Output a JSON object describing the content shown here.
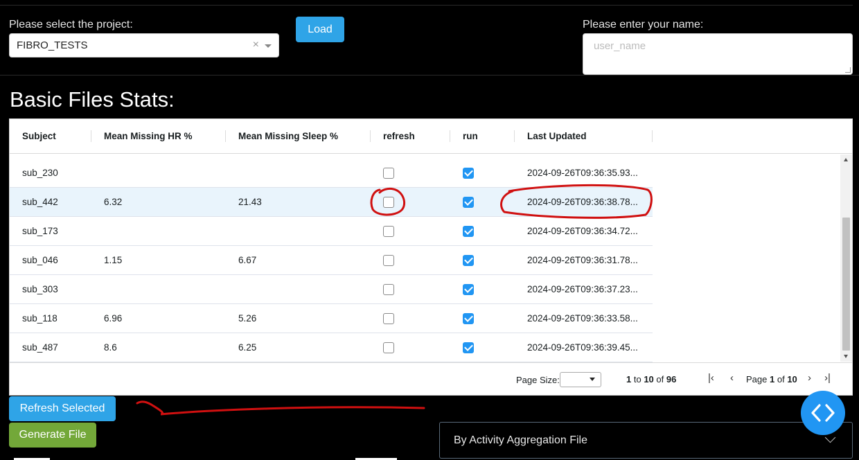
{
  "project": {
    "label": "Please select the project:",
    "selected": "FIBRO_TESTS",
    "clear_glyph": "×"
  },
  "load_button": "Load",
  "name_field": {
    "label": "Please enter your name:",
    "placeholder": "user_name"
  },
  "section_title": "Basic Files Stats:",
  "table": {
    "columns": [
      "Subject",
      "Mean Missing HR %",
      "Mean Missing Sleep %",
      "refresh",
      "run",
      "Last Updated"
    ],
    "rows": [
      {
        "subject": "sub_230",
        "hr": "",
        "sleep": "",
        "refresh": false,
        "run": true,
        "updated": "2024-09-26T09:36:35.93...",
        "selected": false
      },
      {
        "subject": "sub_442",
        "hr": "6.32",
        "sleep": "21.43",
        "refresh": false,
        "run": true,
        "updated": "2024-09-26T09:36:38.78...",
        "selected": true
      },
      {
        "subject": "sub_173",
        "hr": "",
        "sleep": "",
        "refresh": false,
        "run": true,
        "updated": "2024-09-26T09:36:34.72...",
        "selected": false
      },
      {
        "subject": "sub_046",
        "hr": "1.15",
        "sleep": "6.67",
        "refresh": false,
        "run": true,
        "updated": "2024-09-26T09:36:31.78...",
        "selected": false
      },
      {
        "subject": "sub_303",
        "hr": "",
        "sleep": "",
        "refresh": false,
        "run": true,
        "updated": "2024-09-26T09:36:37.23...",
        "selected": false
      },
      {
        "subject": "sub_118",
        "hr": "6.96",
        "sleep": "5.26",
        "refresh": false,
        "run": true,
        "updated": "2024-09-26T09:36:33.58...",
        "selected": false
      },
      {
        "subject": "sub_487",
        "hr": "8.6",
        "sleep": "6.25",
        "refresh": false,
        "run": true,
        "updated": "2024-09-26T09:36:39.45...",
        "selected": false
      }
    ]
  },
  "pagination": {
    "page_size_label": "Page Size:",
    "row_from": "1",
    "row_to": "10",
    "row_total": "96",
    "to_word": "to",
    "of_word": "of",
    "page_word": "Page",
    "page_current": "1",
    "page_total": "10",
    "first_glyph": "|‹",
    "prev_glyph": "‹",
    "next_glyph": "›",
    "last_glyph": "›|"
  },
  "refresh_selected_button": "Refresh Selected",
  "generate_file_button": "Generate File",
  "aggregation_select": "By Activity Aggregation File",
  "icons": {
    "fab": "code-brackets-icon",
    "annotation_color": "#d01010"
  }
}
